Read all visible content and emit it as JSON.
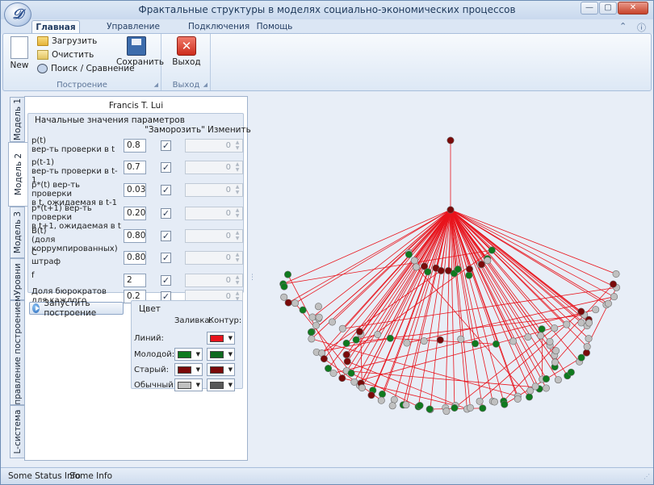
{
  "window": {
    "title": "Фрактальные структуры в моделях социально-экономических процессов",
    "app_icon_letter": "𝒟",
    "controls": {
      "minimize": "—",
      "maximize": "▢",
      "close": "✕"
    }
  },
  "ribbon_tabs": [
    "Главная",
    "Управление построением",
    "Подключения",
    "Помощь"
  ],
  "ribbon_right_icons": {
    "collapse": "⌃",
    "help": "ⓘ"
  },
  "ribbon": {
    "group1_label": "Построение",
    "group2_label": "Выход",
    "new_label": "New",
    "load_label": "Загрузить",
    "clear_label": "Очистить",
    "search_label": "Поиск / Сравнение",
    "save_label": "Сохранить",
    "exit_label": "Выход",
    "launcher_glyph": "◢"
  },
  "side_tabs": [
    "Модель 1",
    "Модель 2",
    "Модель 3",
    "Уровни",
    "Управление построением",
    "L-система"
  ],
  "panel": {
    "author": "Francis T. Lui",
    "params_title": "Начальные значения параметров",
    "freeze_header": "\"Заморозить\"",
    "edit_header": "Изменить",
    "check_mark": "✓",
    "spin_up": "▲",
    "spin_down": "▼",
    "params": [
      {
        "line1": "p(t)",
        "line2": "вер-ть проверки в t",
        "value": "0.8",
        "edit": "0"
      },
      {
        "line1": "p(t-1)",
        "line2": "вер-ть проверки в t-1",
        "value": "0.7",
        "edit": "0"
      },
      {
        "line1": "p*(t)    вер-ть проверки",
        "line2": "в t, ожидаемая в t-1",
        "value": "0.03",
        "edit": "0"
      },
      {
        "line1": "p*(t+1)   вер-ть проверки",
        "line2": "в t+1, ожидаемая в t",
        "value": "0.20",
        "edit": "0"
      },
      {
        "line1": "B(t)",
        "line2": "(доля коррумпированных)",
        "value": "0.80",
        "edit": "0"
      },
      {
        "line1": "C",
        "line2": "штраф",
        "value": "0.80",
        "edit": "0"
      },
      {
        "line1": "f",
        "line2": "",
        "value": "2",
        "edit": "0"
      },
      {
        "line1": "Доля бюрократов",
        "line2": "для каждого поколения",
        "value": "0.2",
        "edit": "0"
      }
    ],
    "run_label": "Запустить построение",
    "colors_title": "Цвет",
    "fill_header": "Заливка:",
    "outline_header": "Контур:",
    "dropdown_glyph": "▼",
    "color_rows": [
      {
        "label": "Линий:",
        "fill": null,
        "outline": "#e8141c"
      },
      {
        "label": "Молодой:",
        "fill": "#0f7a1e",
        "outline": "#0f6a1e"
      },
      {
        "label": "Старый:",
        "fill": "#7a0a0a",
        "outline": "#7a0a0a"
      },
      {
        "label": "Обычный:",
        "fill": "#c0c0c0",
        "outline": "#585858"
      }
    ]
  },
  "splitter_glyph": "⋮",
  "plot_colors": {
    "line": "#e8141c",
    "young": "#0f7a1e",
    "old": "#7a0a0a",
    "normal": "#c0c0c0"
  },
  "status": {
    "item1": "Some Status Info",
    "item2": "Some Info",
    "grip": "⋰"
  }
}
